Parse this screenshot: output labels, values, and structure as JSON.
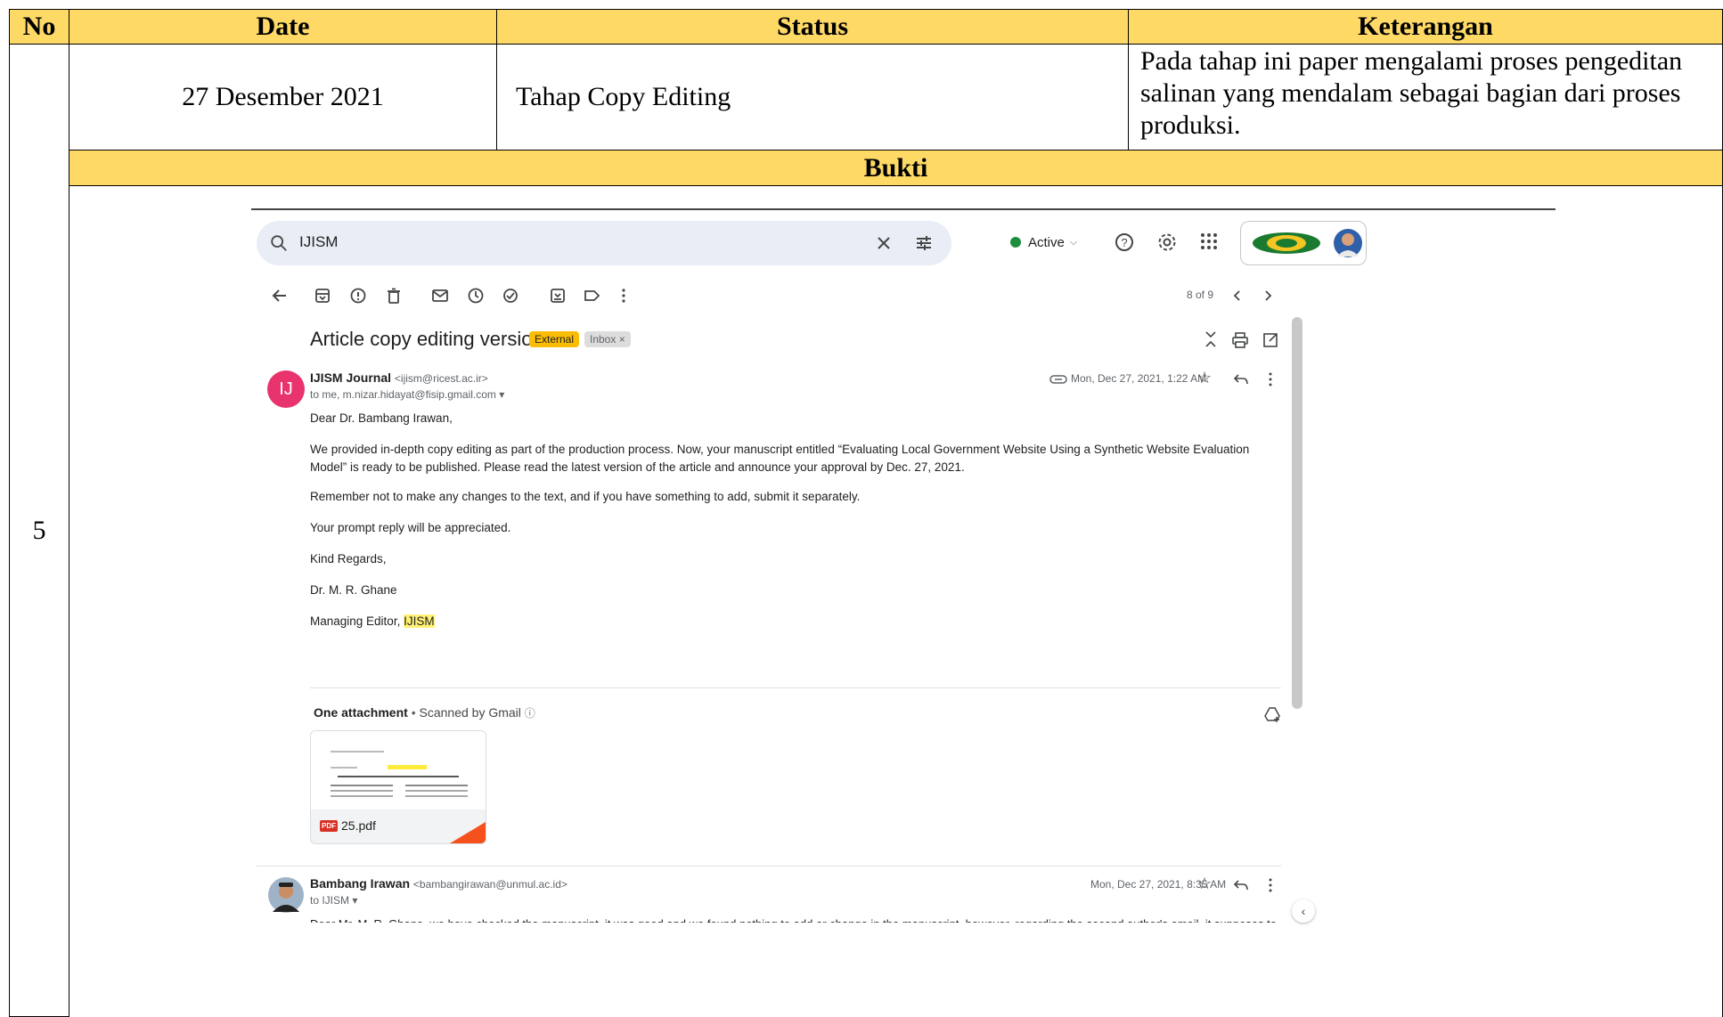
{
  "table": {
    "headers": {
      "no": "No",
      "date": "Date",
      "status": "Status",
      "keterangan": "Keterangan"
    },
    "row": {
      "no": "5",
      "date": "27 Desember 2021",
      "status": "Tahap Copy Editing",
      "keterangan": "Pada tahap ini paper mengalami proses pengeditan salinan yang mendalam sebagai bagian dari proses produksi."
    },
    "bukti_label": "Bukti"
  },
  "gmail": {
    "search_value": "IJISM",
    "status_label": "Active",
    "pager": "8 of 9",
    "subject": "Article copy editing version",
    "label_external": "External",
    "label_inbox": "Inbox",
    "message1": {
      "avatar_initials": "IJ",
      "sender_name": "IJISM Journal",
      "sender_email": "<ijism@ricest.ac.ir>",
      "recipients": "to me, m.nizar.hidayat@fisip.gmail.com",
      "date": "Mon, Dec 27, 2021, 1:22 AM",
      "greeting": "Dear Dr. Bambang Irawan,",
      "para1": "We provided in-depth copy editing as part of the production process. Now, your manuscript entitled “Evaluating Local Government Website Using a Synthetic Website Evaluation Model” is ready to be published. Please read the latest version of the article and announce your approval by Dec. 27, 2021.",
      "para2": "Remember not to make any changes to the text, and if you have something to add, submit it separately.",
      "para3": "Your prompt reply will be appreciated.",
      "closing": "Kind Regards,",
      "signature_name": "Dr. M. R. Ghane",
      "signature_title": "Managing Editor,",
      "signature_org": "IJISM"
    },
    "attachment": {
      "heading": "One attachment",
      "scanned": "Scanned by Gmail",
      "file_name": "25.pdf",
      "file_type": "PDF"
    },
    "message2": {
      "sender_name": "Bambang Irawan",
      "sender_email": "<bambangirawan@unmul.ac.id>",
      "recipients": "to IJISM",
      "date": "Mon, Dec 27, 2021, 8:35 AM",
      "preview": "Dear Mr. M. R. Ghane,  we have checked the manuscript, it was good and we found nothing to add or change in the manuscript, however, regarding the second author's email, it supposes to be"
    },
    "colors": {
      "accent_yellow": "#fed966",
      "avatar_pink": "#e8336d",
      "external_chip": "#fbbc04",
      "active_green": "#1e8e3e"
    }
  }
}
